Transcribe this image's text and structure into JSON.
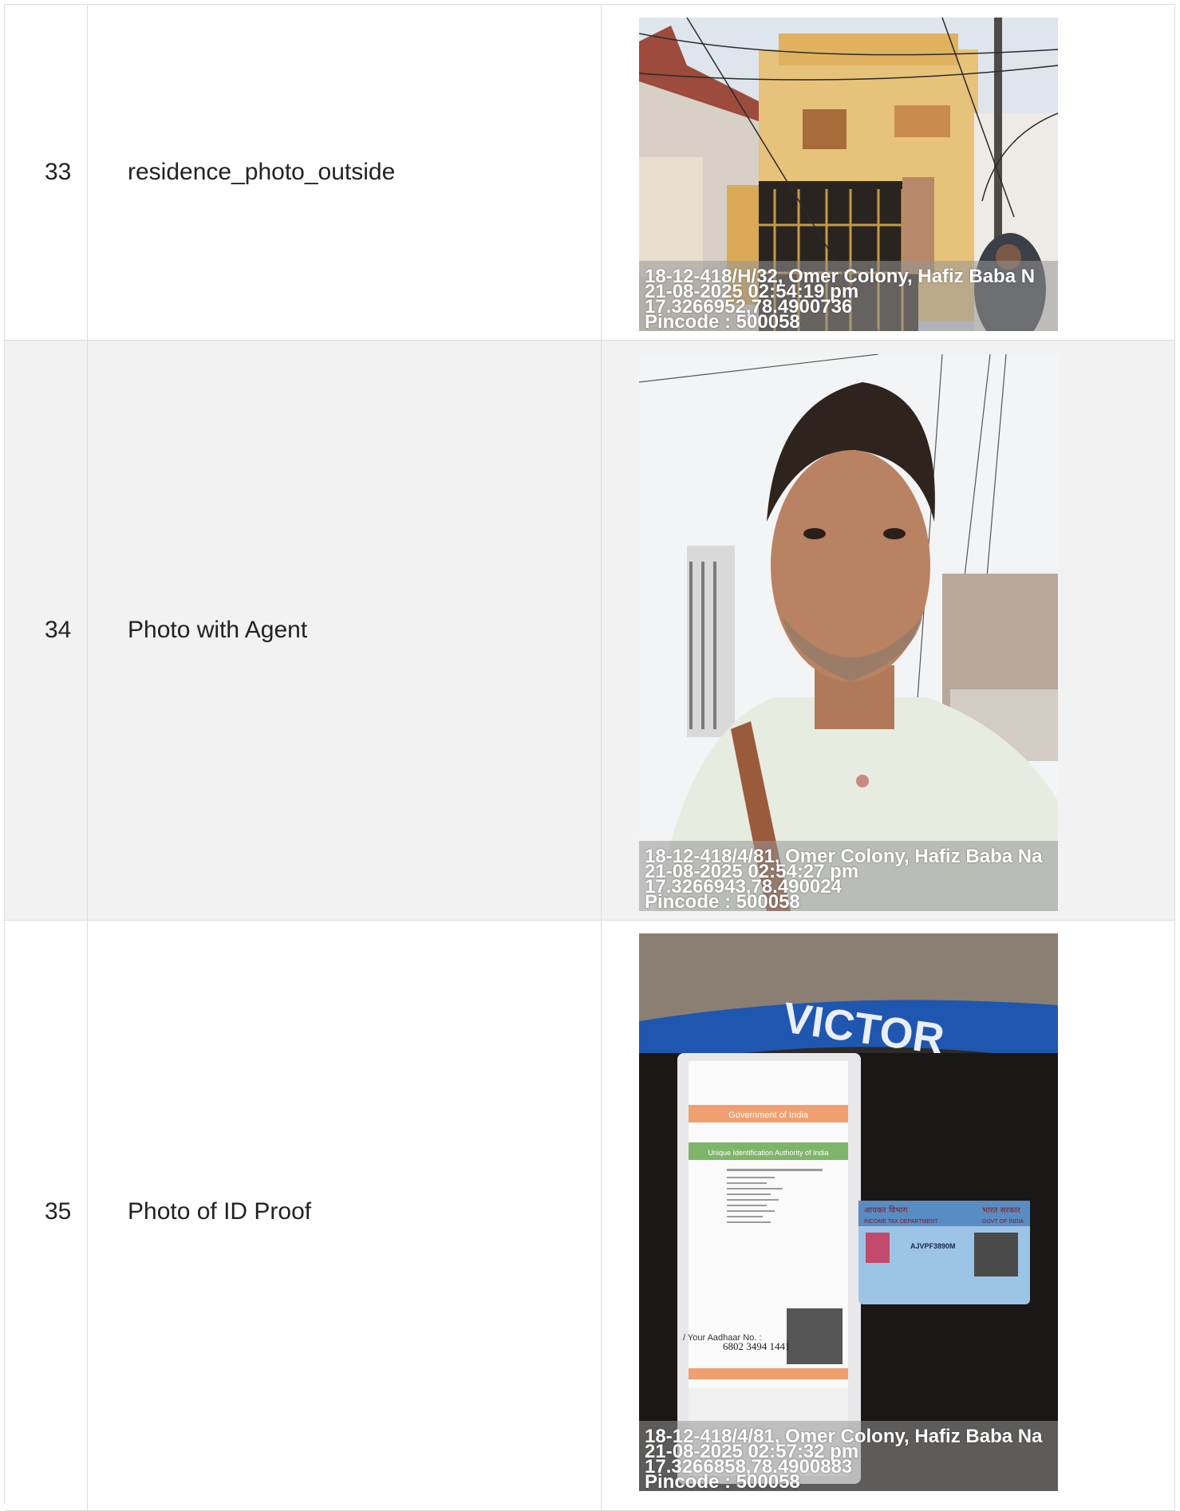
{
  "rows": [
    {
      "number": "33",
      "label": "residence_photo_outside",
      "photo": {
        "subject": "house-exterior",
        "stamp": {
          "address": "18-12-418/H/32, Omer Colony, Hafiz Baba N",
          "datetime": "21-08-2025 02:54:19 pm",
          "coordinates": "17.3266952,78.4900736",
          "pincode": "Pincode : 500058"
        }
      }
    },
    {
      "number": "34",
      "label": "Photo with Agent",
      "photo": {
        "subject": "agent-selfie",
        "stamp": {
          "address": "18-12-418/4/81, Omer Colony, Hafiz Baba Na",
          "datetime": "21-08-2025 02:54:27 pm",
          "coordinates": "17.3266943,78.490024",
          "pincode": "Pincode : 500058"
        }
      }
    },
    {
      "number": "35",
      "label": "Photo of ID Proof",
      "photo": {
        "subject": "id-documents",
        "card_text": {
          "aadhaar_number": "6802 3494 1441",
          "aadhaar_caption": "/ Your Aadhaar No. :",
          "pan_number": "AJVPF3890M",
          "pan_header_left": "आयकर विभाग",
          "pan_header_right": "भारत सरकार",
          "pan_dept": "INCOME TAX DEPARTMENT",
          "pan_govt": "GOVT OF INDIA",
          "aadhaar_govt": "Government of India",
          "aadhaar_uidai": "Unique Identification Authority of India",
          "bike_brand": "VICTOR"
        },
        "stamp": {
          "address": "18-12-418/4/81, Omer Colony, Hafiz Baba Na",
          "datetime": "21-08-2025 02:57:32 pm",
          "coordinates": "17.3266858,78.4900883",
          "pincode": "Pincode : 500058"
        }
      }
    }
  ]
}
